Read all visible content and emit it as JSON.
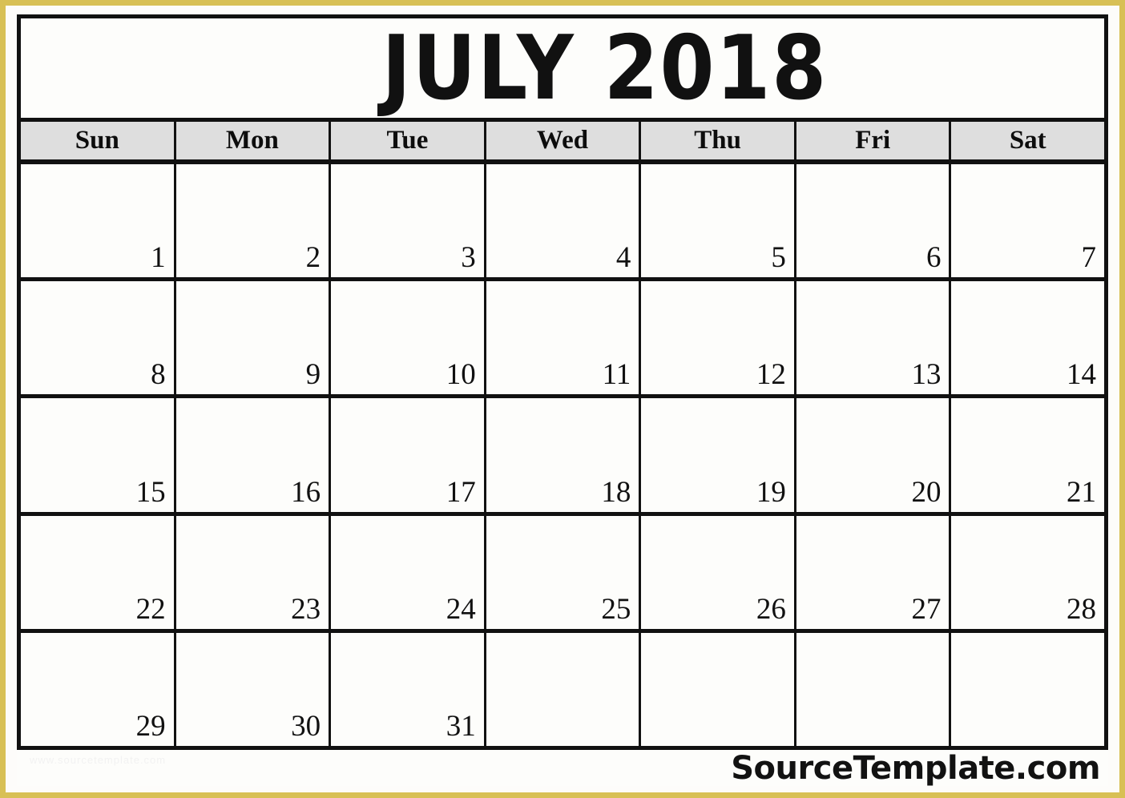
{
  "colors": {
    "outer_frame": "#d8c055",
    "grid_line": "#111111",
    "weekday_header_bg": "#dedede",
    "page_bg": "#fdfdfb",
    "text": "#111111"
  },
  "calendar": {
    "title": "JULY 2018",
    "month": "JULY",
    "year": "2018",
    "weekdays": [
      "Sun",
      "Mon",
      "Tue",
      "Wed",
      "Thu",
      "Fri",
      "Sat"
    ],
    "weeks": [
      [
        {
          "number": "1",
          "empty": false
        },
        {
          "number": "2",
          "empty": false
        },
        {
          "number": "3",
          "empty": false
        },
        {
          "number": "4",
          "empty": false
        },
        {
          "number": "5",
          "empty": false
        },
        {
          "number": "6",
          "empty": false
        },
        {
          "number": "7",
          "empty": false
        }
      ],
      [
        {
          "number": "8",
          "empty": false
        },
        {
          "number": "9",
          "empty": false
        },
        {
          "number": "10",
          "empty": false
        },
        {
          "number": "11",
          "empty": false
        },
        {
          "number": "12",
          "empty": false
        },
        {
          "number": "13",
          "empty": false
        },
        {
          "number": "14",
          "empty": false
        }
      ],
      [
        {
          "number": "15",
          "empty": false
        },
        {
          "number": "16",
          "empty": false
        },
        {
          "number": "17",
          "empty": false
        },
        {
          "number": "18",
          "empty": false
        },
        {
          "number": "19",
          "empty": false
        },
        {
          "number": "20",
          "empty": false
        },
        {
          "number": "21",
          "empty": false
        }
      ],
      [
        {
          "number": "22",
          "empty": false
        },
        {
          "number": "23",
          "empty": false
        },
        {
          "number": "24",
          "empty": false
        },
        {
          "number": "25",
          "empty": false
        },
        {
          "number": "26",
          "empty": false
        },
        {
          "number": "27",
          "empty": false
        },
        {
          "number": "28",
          "empty": false
        }
      ],
      [
        {
          "number": "29",
          "empty": false
        },
        {
          "number": "30",
          "empty": false
        },
        {
          "number": "31",
          "empty": false
        },
        {
          "number": "",
          "empty": true
        },
        {
          "number": "",
          "empty": true
        },
        {
          "number": "",
          "empty": true
        },
        {
          "number": "",
          "empty": true
        }
      ]
    ]
  },
  "footer": {
    "brand": "SourceTemplate.com",
    "watermark": "www.sourcetemplate.com"
  }
}
